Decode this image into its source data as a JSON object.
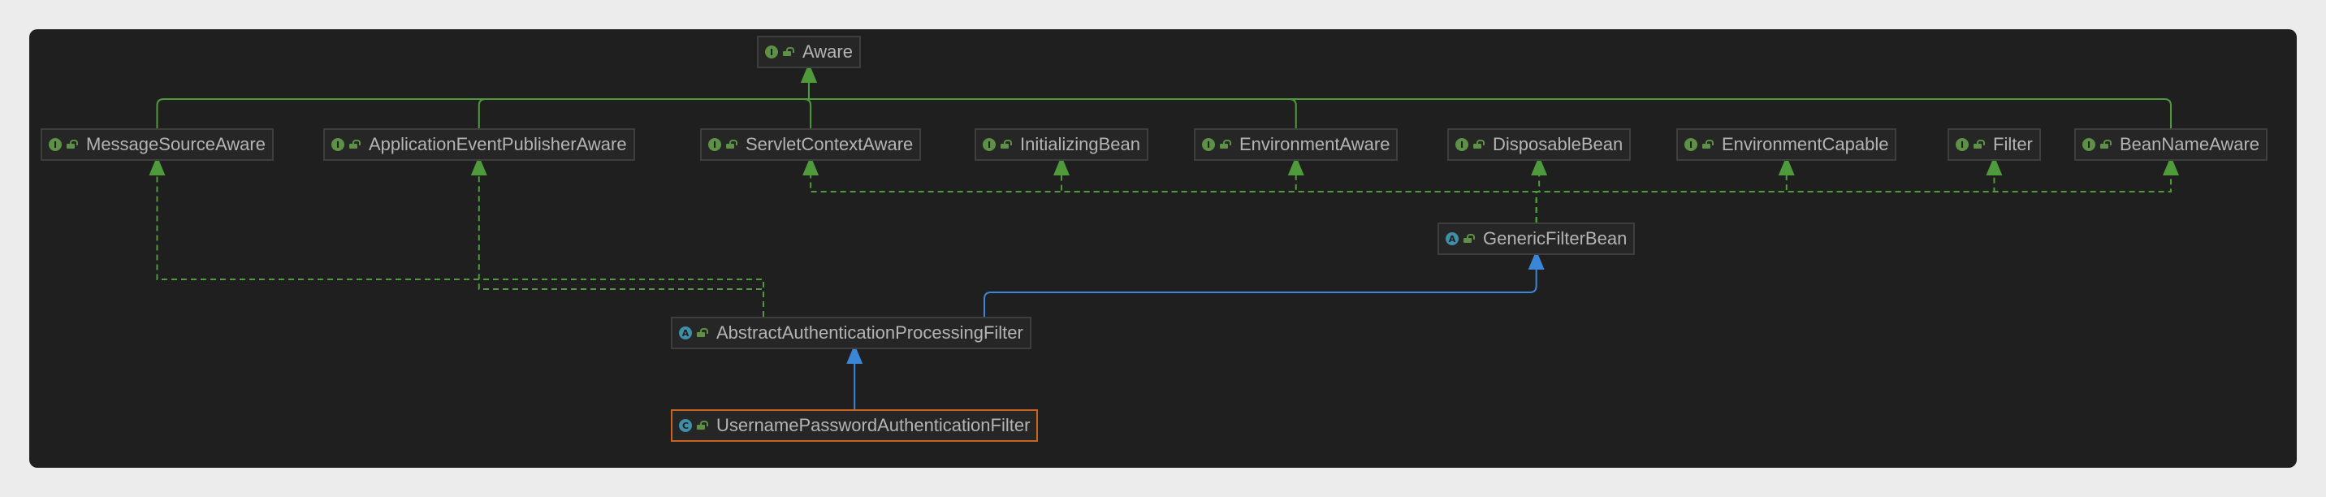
{
  "diagram": {
    "nodes": [
      {
        "id": "aware",
        "label": "Aware",
        "kind": "interface",
        "badge": "I"
      },
      {
        "id": "msa",
        "label": "MessageSourceAware",
        "kind": "interface",
        "badge": "I"
      },
      {
        "id": "aepa",
        "label": "ApplicationEventPublisherAware",
        "kind": "interface",
        "badge": "I"
      },
      {
        "id": "sca",
        "label": "ServletContextAware",
        "kind": "interface",
        "badge": "I"
      },
      {
        "id": "ib",
        "label": "InitializingBean",
        "kind": "interface",
        "badge": "I"
      },
      {
        "id": "ea",
        "label": "EnvironmentAware",
        "kind": "interface",
        "badge": "I"
      },
      {
        "id": "db",
        "label": "DisposableBean",
        "kind": "interface",
        "badge": "I"
      },
      {
        "id": "ec",
        "label": "EnvironmentCapable",
        "kind": "interface",
        "badge": "I"
      },
      {
        "id": "filter",
        "label": "Filter",
        "kind": "interface",
        "badge": "I"
      },
      {
        "id": "bna",
        "label": "BeanNameAware",
        "kind": "interface",
        "badge": "I"
      },
      {
        "id": "gfb",
        "label": "GenericFilterBean",
        "kind": "abstract",
        "badge": "A"
      },
      {
        "id": "aapf",
        "label": "AbstractAuthenticationProcessingFilter",
        "kind": "abstract",
        "badge": "A"
      },
      {
        "id": "upaf",
        "label": "UsernamePasswordAuthenticationFilter",
        "kind": "class",
        "badge": "C",
        "selected": true
      }
    ],
    "edges": [
      {
        "from": "msa",
        "to": "aware",
        "type": "extends"
      },
      {
        "from": "aepa",
        "to": "aware",
        "type": "extends"
      },
      {
        "from": "sca",
        "to": "aware",
        "type": "extends"
      },
      {
        "from": "ea",
        "to": "aware",
        "type": "extends"
      },
      {
        "from": "bna",
        "to": "aware",
        "type": "extends"
      },
      {
        "from": "gfb",
        "to": "sca",
        "type": "implements"
      },
      {
        "from": "gfb",
        "to": "ib",
        "type": "implements"
      },
      {
        "from": "gfb",
        "to": "ea",
        "type": "implements"
      },
      {
        "from": "gfb",
        "to": "db",
        "type": "implements"
      },
      {
        "from": "gfb",
        "to": "ec",
        "type": "implements"
      },
      {
        "from": "gfb",
        "to": "filter",
        "type": "implements"
      },
      {
        "from": "gfb",
        "to": "bna",
        "type": "implements"
      },
      {
        "from": "aapf",
        "to": "msa",
        "type": "implements"
      },
      {
        "from": "aapf",
        "to": "aepa",
        "type": "implements"
      },
      {
        "from": "aapf",
        "to": "gfb",
        "type": "inherits"
      },
      {
        "from": "upaf",
        "to": "aapf",
        "type": "inherits"
      }
    ],
    "colors": {
      "interface_edge": "#4f9a3a",
      "inherit_edge": "#3c86d8",
      "selected_border": "#c96420"
    }
  }
}
